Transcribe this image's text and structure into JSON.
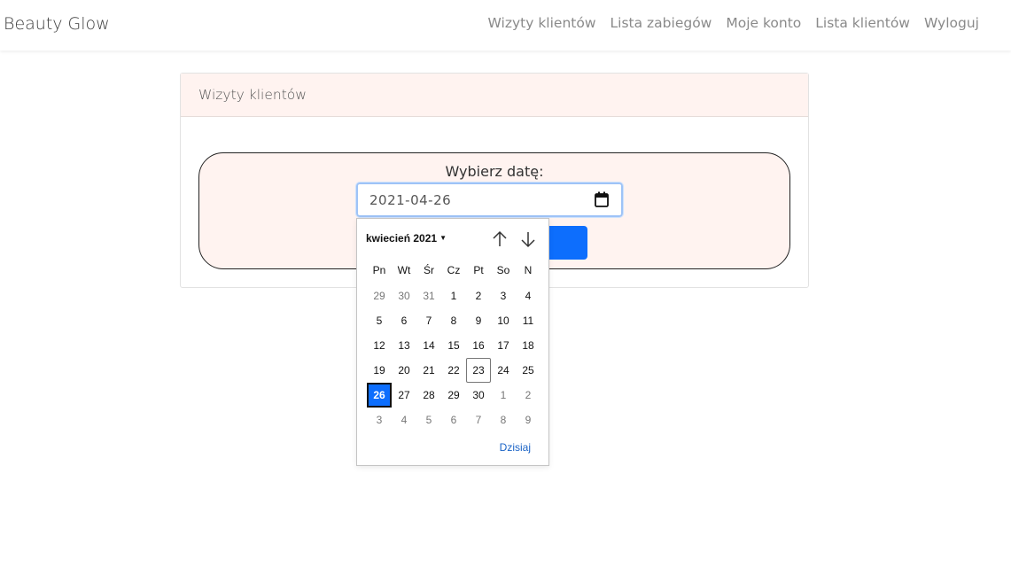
{
  "navbar": {
    "brand": "Beauty Glow",
    "links": [
      "Wizyty klientów",
      "Lista zabiegów",
      "Moje konto",
      "Lista klientów",
      "Wyloguj"
    ]
  },
  "card": {
    "title": "Wizyty klientów",
    "date_label": "Wybierz datę:",
    "date_value": "2021-04-26"
  },
  "picker": {
    "month_label": "kwiecień 2021",
    "weekdays": [
      "Pn",
      "Wt",
      "Śr",
      "Cz",
      "Pt",
      "So",
      "N"
    ],
    "weeks": [
      [
        "29",
        "30",
        "31",
        "1",
        "2",
        "3",
        "4"
      ],
      [
        "5",
        "6",
        "7",
        "8",
        "9",
        "10",
        "11"
      ],
      [
        "12",
        "13",
        "14",
        "15",
        "16",
        "17",
        "18"
      ],
      [
        "19",
        "20",
        "21",
        "22",
        "23",
        "24",
        "25"
      ],
      [
        "26",
        "27",
        "28",
        "29",
        "30",
        "1",
        "2"
      ],
      [
        "3",
        "4",
        "5",
        "6",
        "7",
        "8",
        "9"
      ]
    ],
    "today_label": "Dzisiaj"
  },
  "colors": {
    "accent": "#0d6efd",
    "card_header_bg": "#fff3f0"
  }
}
